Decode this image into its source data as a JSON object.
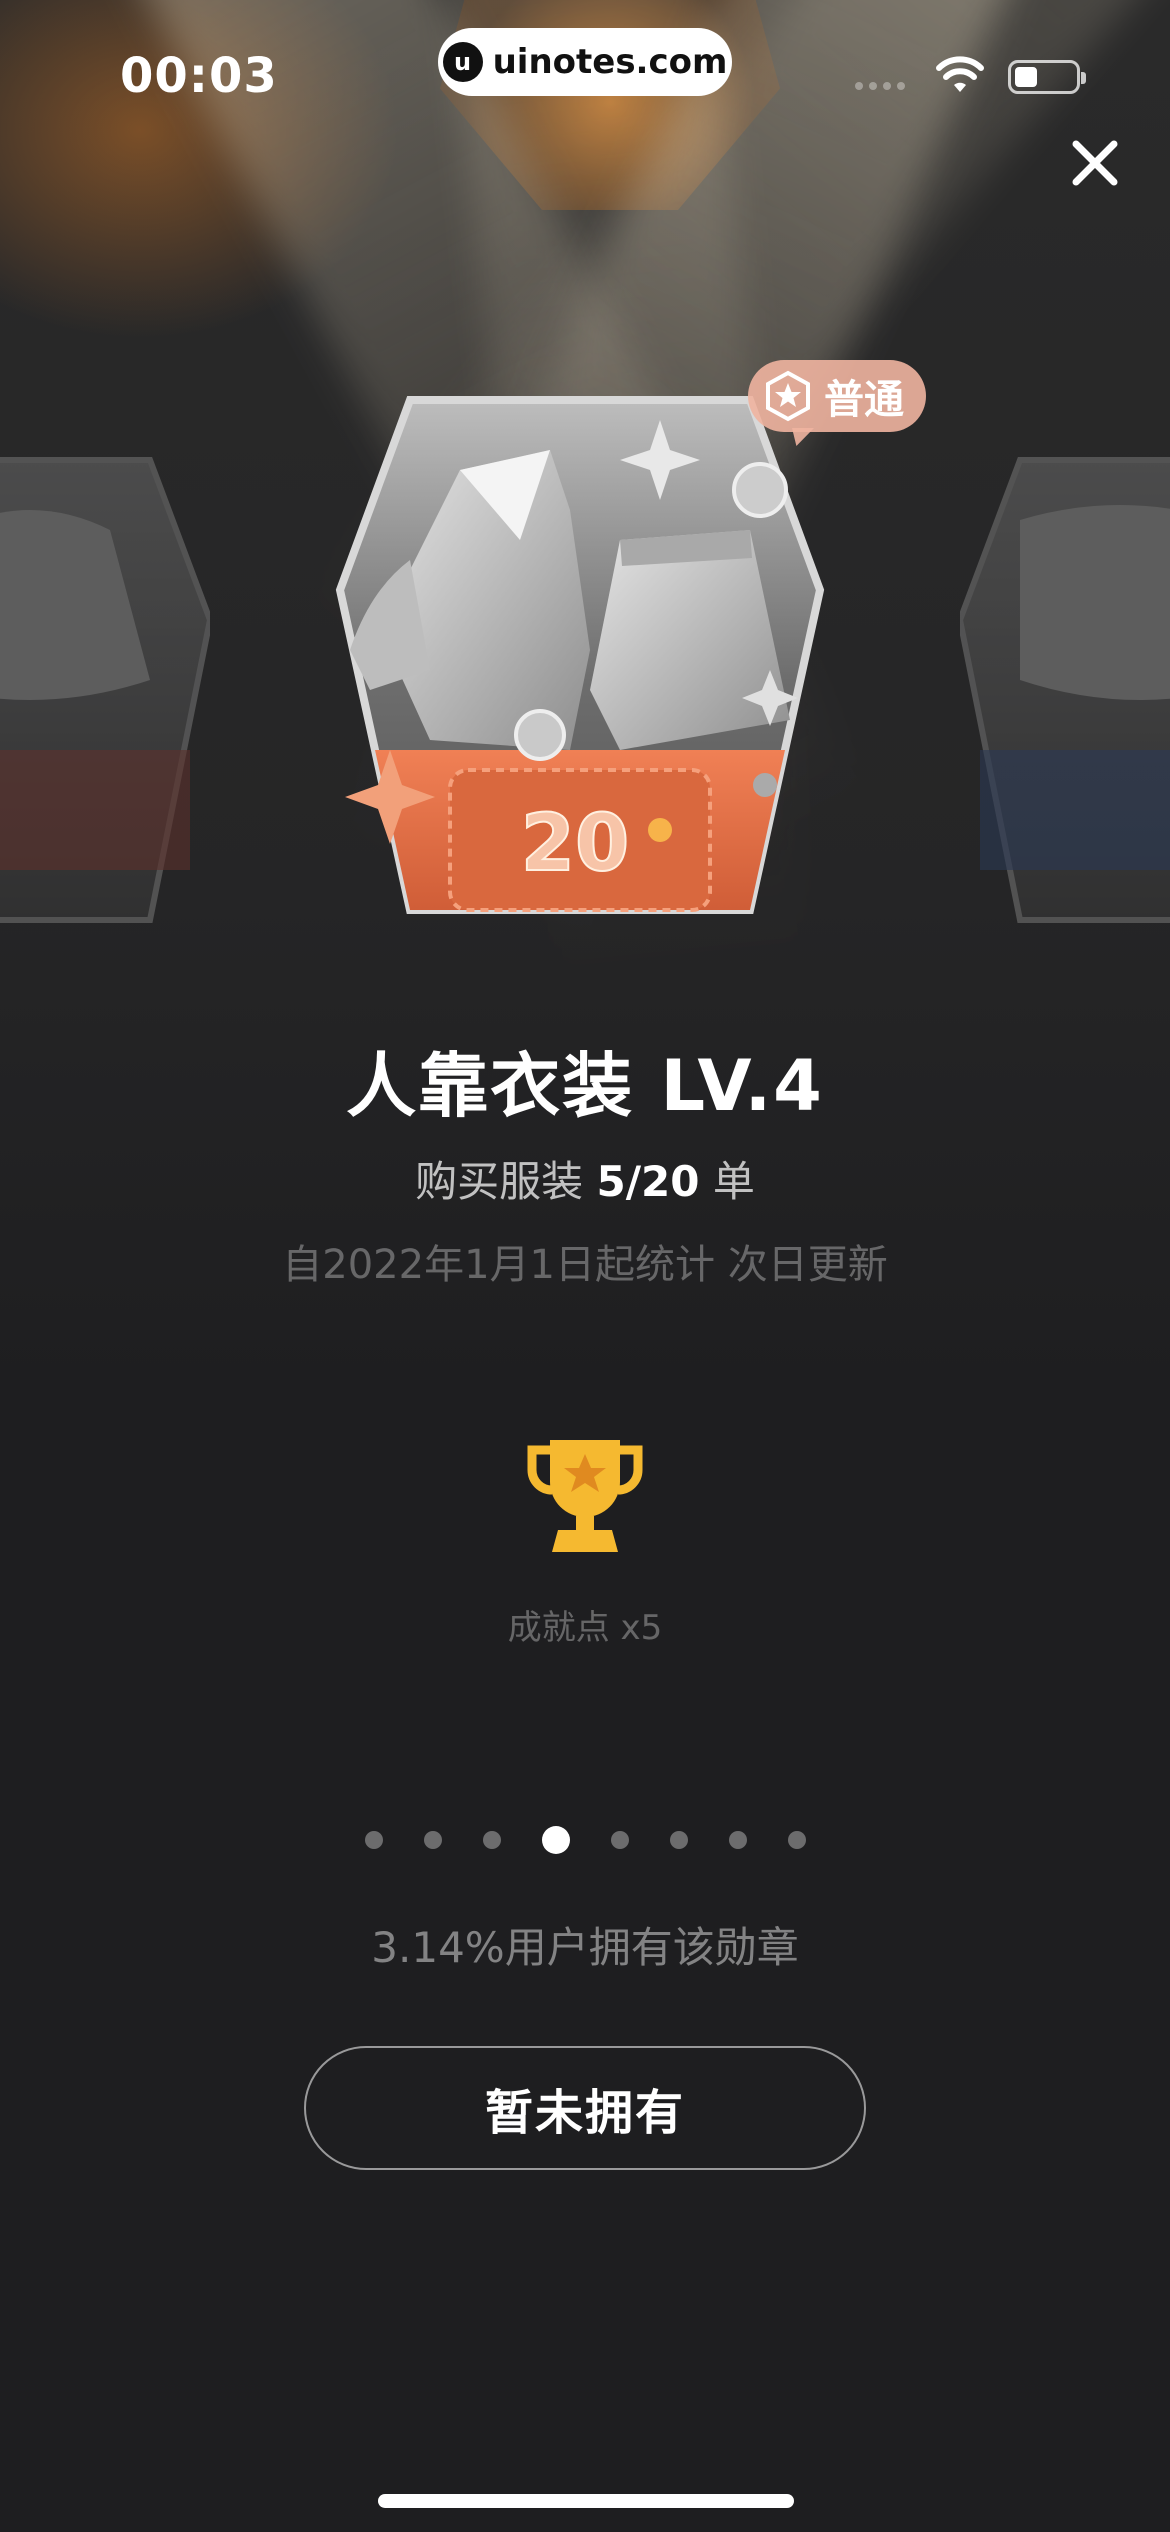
{
  "status_bar": {
    "time": "00:03",
    "watermark": "uinotes.com",
    "watermark_logo": "u"
  },
  "badge": {
    "rarity": "普通",
    "counter_value": "20",
    "title": "人靠衣装 LV.4",
    "progress_prefix": "购买服装",
    "progress_value": "5/20",
    "progress_suffix": "单",
    "note": "自2022年1月1日起统计 次日更新",
    "reward": "成就点 x5",
    "owners": "3.14%用户拥有该勋章",
    "status_button": "暂未拥有"
  },
  "pager": {
    "count": 8,
    "active_index": 3
  },
  "colors": {
    "background": "#1e1e20",
    "accent_orange": "#e8744a",
    "trophy_gold": "#f5b930",
    "rarity_tag": "#f0b4a0"
  },
  "icons": [
    "close-icon",
    "wifi-icon",
    "battery-icon",
    "star-badge-icon",
    "trophy-icon"
  ]
}
